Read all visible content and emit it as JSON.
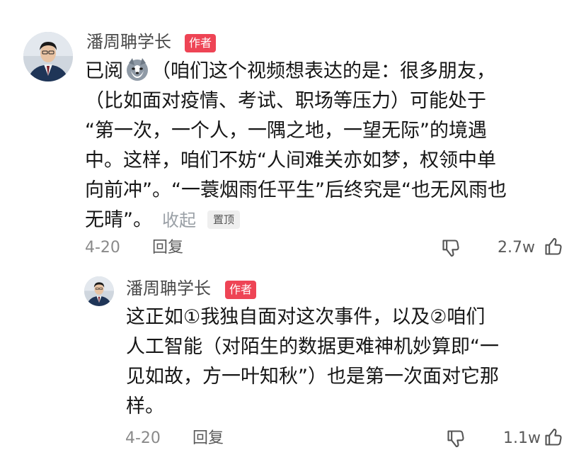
{
  "comment": {
    "username": "潘周聃学长",
    "author_badge": "作者",
    "lines": [
      {
        "pre": "已阅",
        "post": "（咱们这个视频想表达的是：很多朋友，"
      },
      {
        "text": "（比如面对疫情、考试、职场等压力）可能处于"
      },
      {
        "text": "“第一次，一个人，一隅之地，一望无际”的境遇"
      },
      {
        "text": "中。这样，咱们不妨“人间难关亦如梦，权领中单"
      },
      {
        "text": "向前冲”。“一蓑烟雨任平生”后终究是“也无风雨也"
      },
      {
        "text": "无晴”。"
      }
    ],
    "collapse_label": "收起",
    "pinned_label": "置顶",
    "date": "4-20",
    "reply_label": "回复",
    "like_count": "2.7w"
  },
  "reply": {
    "username": "潘周聃学长",
    "author_badge": "作者",
    "lines": [
      "这正如①我独自面对这次事件，以及②咱们",
      "人工智能（对陌生的数据更难神机妙算即“一",
      "见如故，方一叶知秋”）也是第一次面对它那",
      "样。"
    ],
    "date": "4-20",
    "reply_label": "回复",
    "like_count": "1.1w"
  },
  "icons": {
    "emoji": "husky-dog-emoji",
    "dislike": "thumbs-down-icon",
    "like": "thumbs-up-icon"
  }
}
